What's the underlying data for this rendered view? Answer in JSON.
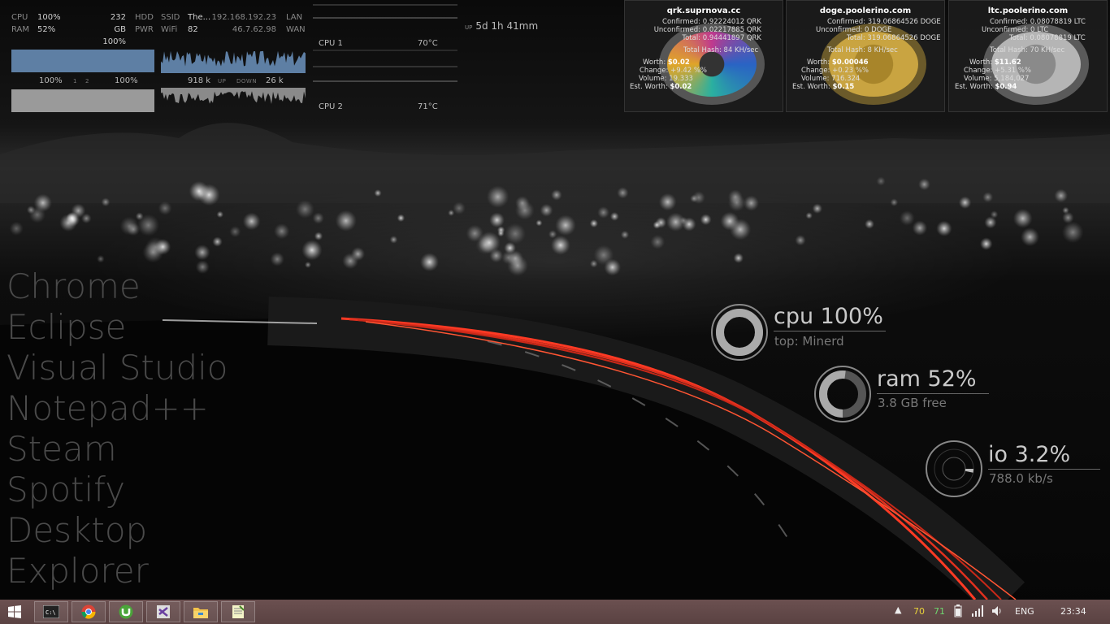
{
  "sysmon": {
    "cpu_label": "CPU",
    "cpu_val": "100%",
    "ram_label": "RAM",
    "ram_val": "52%",
    "hdd_size": "232 GB",
    "hdd_label": "HDD",
    "pwr_val": "100%",
    "pwr_label": "PWR",
    "ssid_label": "SSID",
    "ssid_val": "The...",
    "wifi_label": "WiFi",
    "wifi_val": "82",
    "lan_ip": "192.168.192.23",
    "lan_label": "LAN",
    "wan_ip": "46.7.62.98",
    "wan_label": "WAN",
    "core1_pct": "100%",
    "core_a": "1",
    "core_b": "2",
    "core2_pct": "100%",
    "up_val": "918 k",
    "up_label": "UP",
    "down_label": "DOWN",
    "down_val": "26 k"
  },
  "temps": {
    "cpu1_label": "CPU 1",
    "cpu1_val": "70°C",
    "cpu2_label": "CPU 2",
    "cpu2_val": "71°C",
    "uptime_label": "UP",
    "uptime_val": "5d 1h 41mm"
  },
  "coins": [
    {
      "name": "qrk.suprnova.cc",
      "confirmed": "Confirmed: 0.92224012 QRK",
      "unconfirmed": "Unconfirmed: 0.02217885 QRK",
      "total": "Total: 0.94441897 QRK",
      "hash": "Total Hash: 84 KH/sec",
      "worth_label": "Worth:",
      "worth": "$0.02",
      "change": "Change: +9.42 %%",
      "volume": "Volume: 19.333",
      "est_label": "Est. Worth:",
      "est": "$0.02"
    },
    {
      "name": "doge.poolerino.com",
      "confirmed": "Confirmed: 319.06864526 DOGE",
      "unconfirmed": "Unconfirmed: 0 DOGE",
      "total": "Total: 319.06864526 DOGE",
      "hash": "Total Hash: 8 KH/sec",
      "worth_label": "Worth:",
      "worth": "$0.00046",
      "change": "Change: +0.23 %%",
      "volume": "Volume: 716.324",
      "est_label": "Est. Worth:",
      "est": "$0.15"
    },
    {
      "name": "ltc.poolerino.com",
      "confirmed": "Confirmed: 0.08078819 LTC",
      "unconfirmed": "Unconfirmed: 0 LTC",
      "total": "Total: 0.08078819 LTC",
      "hash": "Total Hash: 70 KH/sec",
      "worth_label": "Worth:",
      "worth": "$11.62",
      "change": "Change: +5.31 %%",
      "volume": "Volume: 5,184,027",
      "est_label": "Est. Worth:",
      "est": "$0.94"
    }
  ],
  "launcher": [
    "Chrome",
    "Eclipse",
    "Visual Studio",
    "Notepad++",
    "Steam",
    "Spotify",
    "Desktop",
    "Explorer"
  ],
  "rings": {
    "cpu_title": "cpu 100%",
    "cpu_sub": "top: Minerd",
    "cpu_level": 1.0,
    "ram_title": "ram 52%",
    "ram_sub": "3.8 GB free",
    "ram_level": 0.52,
    "io_title": "io 3.2%",
    "io_sub": "788.0 kb/s",
    "io_level": 0.032
  },
  "taskbar": {
    "apps": [
      "start-icon",
      "cmd-icon",
      "chrome-icon",
      "utorrent-icon",
      "visual-studio-icon",
      "explorer-icon",
      "notepad-icon"
    ],
    "tray_temp1": "70",
    "tray_temp2": "71",
    "lang": "ENG",
    "clock": "23:34"
  },
  "colors": {
    "accent_blue": "#5e7fa4",
    "taskbar": "#5a4242",
    "light_trail": "#e0301e",
    "temp1": "#e8d23a",
    "temp2": "#6fd66f"
  }
}
